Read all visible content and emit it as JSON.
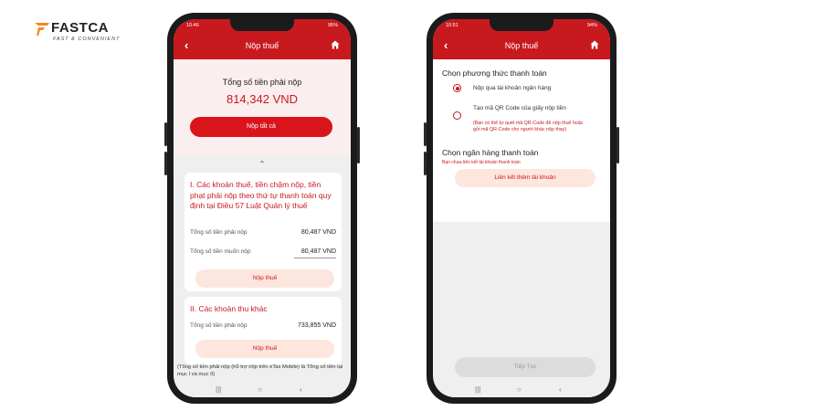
{
  "logo": {
    "name": "FASTCA",
    "tagline": "FAST & CONVENIENT"
  },
  "phone1": {
    "status": {
      "time": "10:46",
      "right": "95%"
    },
    "appbar": {
      "title": "Nộp thuế"
    },
    "summary": {
      "label": "Tổng số tiền phải nộp",
      "amount": "814,342 VND",
      "pay_all_label": "Nộp tất cả"
    },
    "section1": {
      "heading": "I. Các khoản thuế, tiền chậm nộp, tiền phạt phải nộp theo thứ tự thanh toán quy định tại Điều 57 Luật Quản lý thuế",
      "row1_label": "Tổng số tiền phải nộp",
      "row1_value": "80,487 VND",
      "row2_label": "Tổng số tiền muốn nộp",
      "row2_value": "80,487 VND",
      "button": "Nộp thuế"
    },
    "section2": {
      "heading": "II. Các khoản thu khác",
      "row1_label": "Tổng số tiền phải nộp",
      "row1_value": "733,855 VND",
      "button": "Nộp thuế"
    },
    "note": "(Tổng số tiền phải nộp (hỗ trợ nộp trên eTax Mobile) là Tổng số tiền tại mục I và mục II)"
  },
  "phone2": {
    "status": {
      "time": "10:51",
      "right": "94%"
    },
    "appbar": {
      "title": "Nộp thuế"
    },
    "method_heading": "Chọn phương thức thanh toán",
    "option1": "Nộp qua tài khoản ngân hàng",
    "option2": "Tạo mã QR Code của giấy nộp tiền",
    "option2_sub": "(Bạn có thể tự quét mã QR-Code để nộp thuế hoặc gửi mã QR-Code cho người khác nộp thay)",
    "bank_heading": "Chọn ngân hàng thanh toán",
    "bank_sub": "Bạn chưa liên kết tài khoản thanh toán",
    "link_button": "Liên kết thêm tài khoản",
    "continue_button": "Tiếp Tục"
  },
  "colors": {
    "brand_red": "#c8191e",
    "pink": "#fde6dd",
    "logo_orange": "#f08a24"
  }
}
